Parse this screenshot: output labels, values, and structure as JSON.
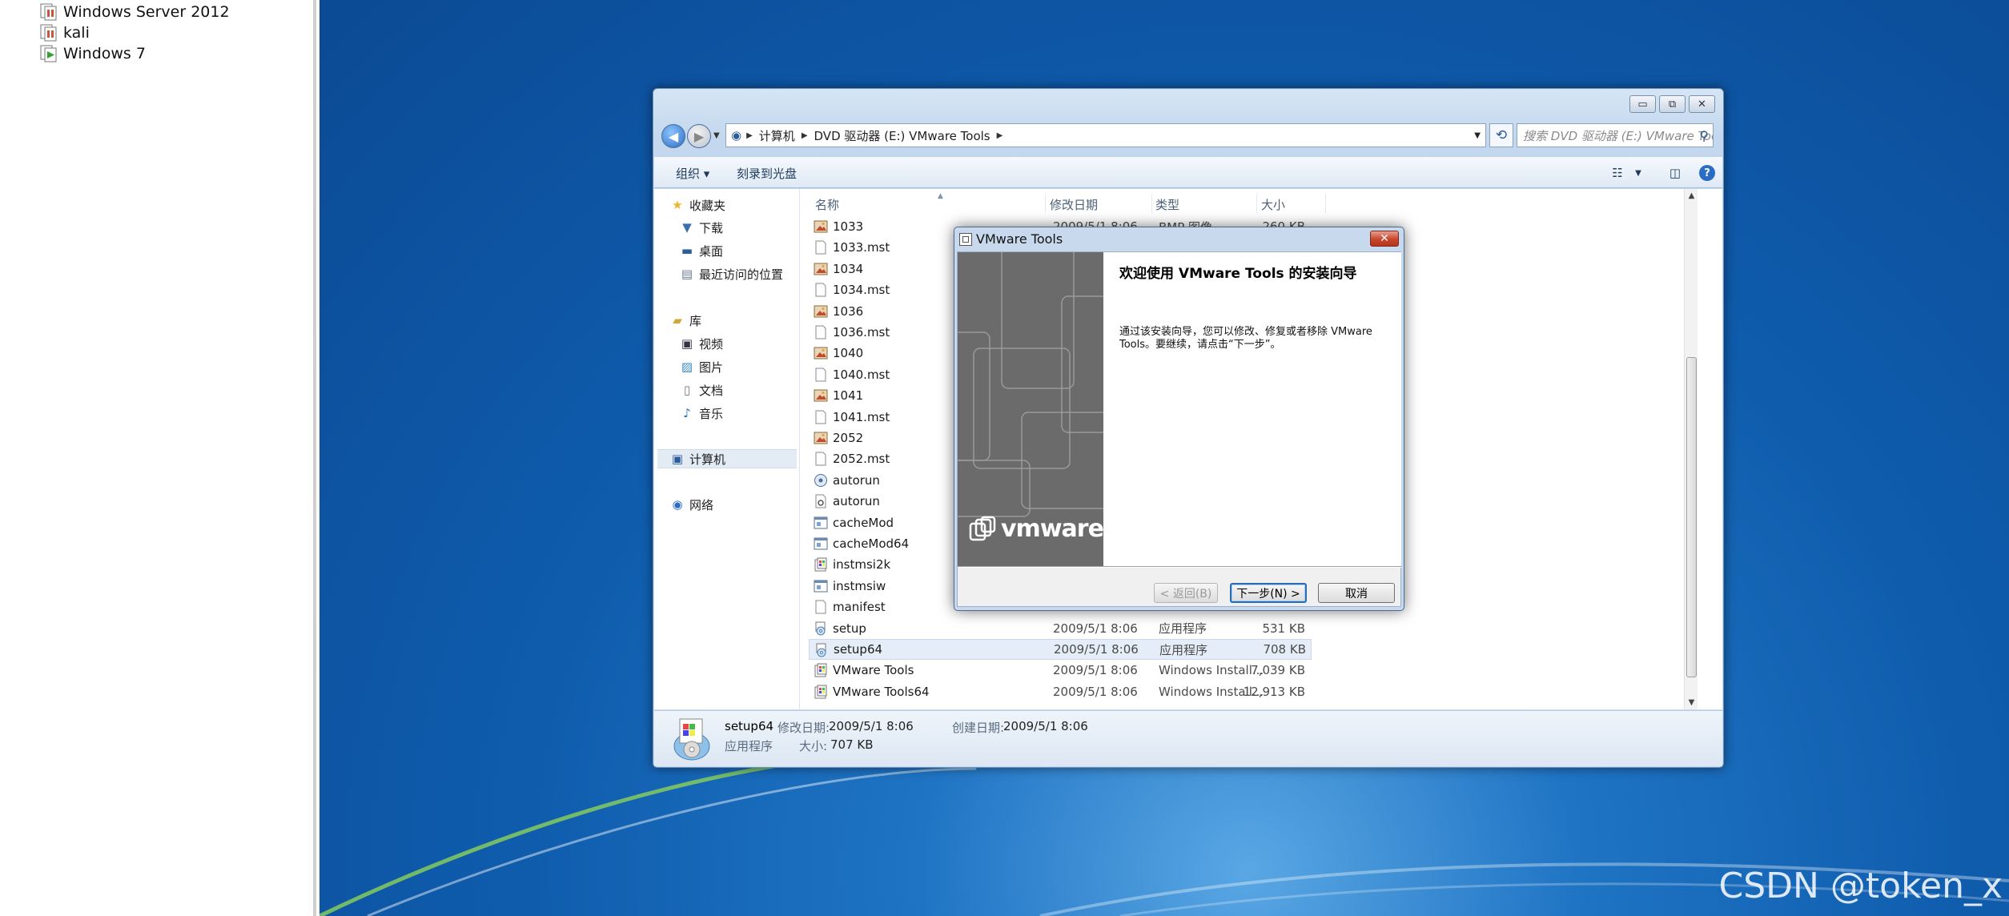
{
  "vm_library": {
    "items": [
      {
        "label": "Windows Server 2012",
        "running": false
      },
      {
        "label": "kali",
        "running": false
      },
      {
        "label": "Windows 7",
        "running": true
      }
    ]
  },
  "explorer": {
    "caption_buttons": {
      "minimize": "▭",
      "maximize": "⧉",
      "close": "✕"
    },
    "breadcrumb": [
      "计算机",
      "DVD 驱动器 (E:) VMware Tools"
    ],
    "search_placeholder": "搜索 DVD 驱动器 (E:) VMware Tools",
    "toolbar": {
      "organize": "组织 ▾",
      "burn": "刻录到光盘"
    },
    "nav_pane": {
      "favorites": "收藏夹",
      "favorites_items": [
        "下载",
        "桌面",
        "最近访问的位置"
      ],
      "libraries": "库",
      "libraries_items": [
        "视频",
        "图片",
        "文档",
        "音乐"
      ],
      "computer": "计算机",
      "network": "网络"
    },
    "columns": {
      "name": "名称",
      "date": "修改日期",
      "type": "类型",
      "size": "大小"
    },
    "files": [
      {
        "name": "1033",
        "date": "2009/5/1 8:06",
        "type": "BMP 图像",
        "size": "260 KB",
        "icon": "bmp"
      },
      {
        "name": "1033.mst",
        "date": "",
        "type": "",
        "size": "",
        "icon": "file"
      },
      {
        "name": "1034",
        "date": "",
        "type": "",
        "size": "",
        "icon": "bmp"
      },
      {
        "name": "1034.mst",
        "date": "",
        "type": "",
        "size": "",
        "icon": "file"
      },
      {
        "name": "1036",
        "date": "",
        "type": "",
        "size": "",
        "icon": "bmp"
      },
      {
        "name": "1036.mst",
        "date": "",
        "type": "",
        "size": "",
        "icon": "file"
      },
      {
        "name": "1040",
        "date": "",
        "type": "",
        "size": "",
        "icon": "bmp"
      },
      {
        "name": "1040.mst",
        "date": "",
        "type": "",
        "size": "",
        "icon": "file"
      },
      {
        "name": "1041",
        "date": "",
        "type": "",
        "size": "",
        "icon": "bmp"
      },
      {
        "name": "1041.mst",
        "date": "",
        "type": "",
        "size": "",
        "icon": "file"
      },
      {
        "name": "2052",
        "date": "",
        "type": "",
        "size": "",
        "icon": "bmp"
      },
      {
        "name": "2052.mst",
        "date": "",
        "type": "",
        "size": "",
        "icon": "file"
      },
      {
        "name": "autorun",
        "date": "",
        "type": "",
        "size": "",
        "icon": "autorun"
      },
      {
        "name": "autorun",
        "date": "",
        "type": "",
        "size": "",
        "icon": "config"
      },
      {
        "name": "cacheMod",
        "date": "",
        "type": "",
        "size": "",
        "icon": "app"
      },
      {
        "name": "cacheMod64",
        "date": "",
        "type": "",
        "size": "",
        "icon": "app"
      },
      {
        "name": "instmsi2k",
        "date": "",
        "type": "",
        "size": "",
        "icon": "msi"
      },
      {
        "name": "instmsiw",
        "date": "",
        "type": "",
        "size": "",
        "icon": "app"
      },
      {
        "name": "manifest",
        "date": "",
        "type": "",
        "size": "",
        "icon": "file"
      },
      {
        "name": "setup",
        "date": "2009/5/1 8:06",
        "type": "应用程序",
        "size": "531 KB",
        "icon": "setup"
      },
      {
        "name": "setup64",
        "date": "2009/5/1 8:06",
        "type": "应用程序",
        "size": "708 KB",
        "icon": "setup",
        "selected": true
      },
      {
        "name": "VMware Tools",
        "date": "2009/5/1 8:06",
        "type": "Windows Install...",
        "size": "7,039 KB",
        "icon": "msi"
      },
      {
        "name": "VMware Tools64",
        "date": "2009/5/1 8:06",
        "type": "Windows Install...",
        "size": "12,913 KB",
        "icon": "msi"
      }
    ],
    "details": {
      "name": "setup64",
      "modified_label": "修改日期:",
      "modified": "2009/5/1 8:06",
      "created_label": "创建日期:",
      "created": "2009/5/1 8:06",
      "type": "应用程序",
      "size_label": "大小:",
      "size": "707 KB"
    }
  },
  "dialog": {
    "title": "VMware Tools",
    "heading": "欢迎使用 VMware Tools 的安装向导",
    "body": "通过该安装向导，您可以修改、修复或者移除 VMware Tools。要继续，请点击“下一步”。",
    "logo": "vmware",
    "buttons": {
      "back": "< 返回(B)",
      "next": "下一步(N) >",
      "cancel": "取消"
    }
  },
  "watermark": "CSDN @token_x"
}
